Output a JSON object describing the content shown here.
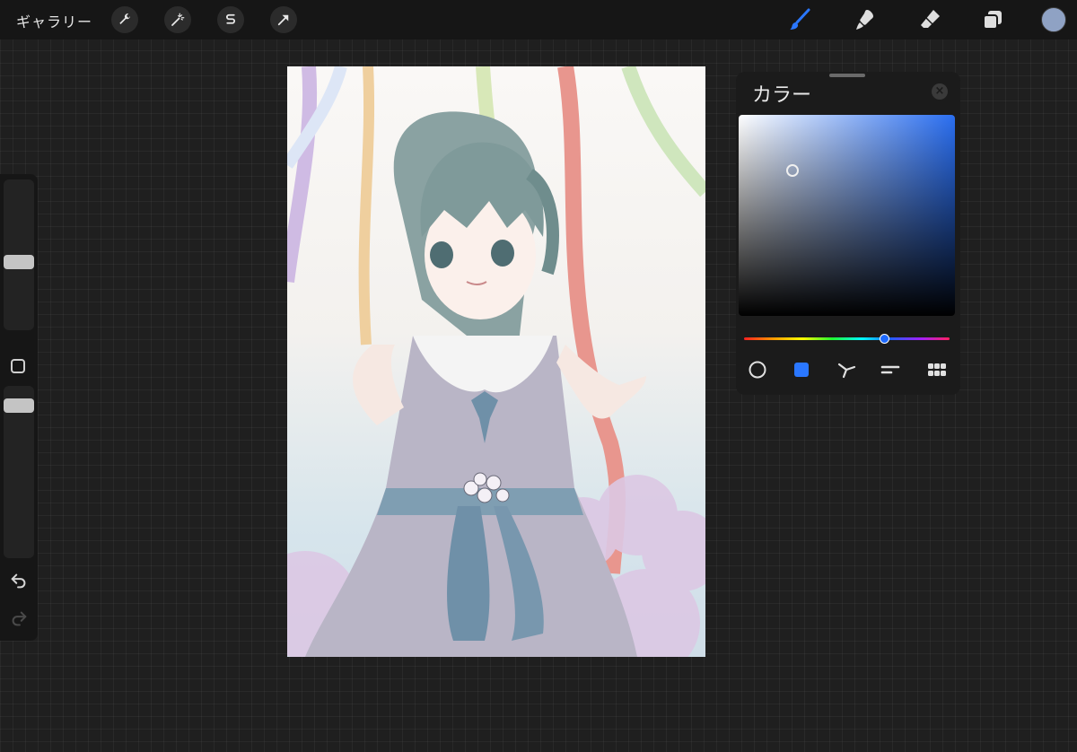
{
  "topbar": {
    "gallery_label": "ギャラリー",
    "left_tools": [
      "wrench-icon",
      "magic-wand-icon",
      "selection-s-icon",
      "transform-arrow-icon"
    ],
    "right_tools": [
      "brush-icon",
      "smudge-icon",
      "eraser-icon",
      "layers-icon"
    ],
    "active_tool": "brush-icon",
    "current_color": "#8fa2c4",
    "accent": "#2a77ff"
  },
  "sidebar": {
    "brush_size_level": 0.45,
    "opacity_level": 0.92,
    "icons": [
      "modifier-square-icon",
      "undo-icon",
      "redo-icon"
    ]
  },
  "color_panel": {
    "title": "カラー",
    "hue_position": 0.68,
    "mode_buttons": [
      "disc-icon",
      "classic-square-icon",
      "harmony-icon",
      "value-sliders-icon",
      "palettes-grid-icon"
    ],
    "active_mode": "classic-square-icon",
    "base_hue_color": "#2a6ef0"
  },
  "canvas": {
    "artwork": "illustration"
  }
}
